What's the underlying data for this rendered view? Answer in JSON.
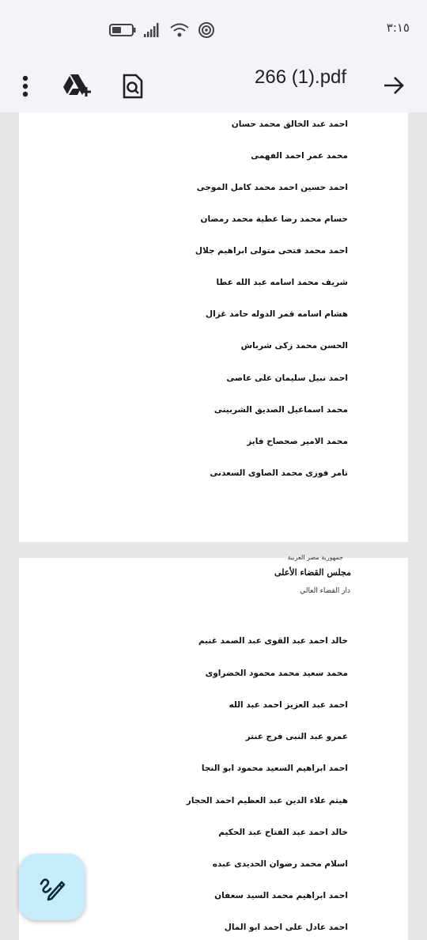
{
  "status": {
    "time": "٣:١٥"
  },
  "appbar": {
    "title": "266 (1).pdf"
  },
  "pages": [
    {
      "lines": [
        "احمد عبد الخالق محمد حسان",
        "محمد عمر احمد الفهمى",
        "احمد حسين احمد محمد كامل الموجى",
        "حسام محمد رضا عطية محمد رمضان",
        "احمد محمد فتحى متولى ابراهيم جلال",
        "شريف محمد اسامه عبد الله عطا",
        "هشام اسامه قمر الدوله حامد غزال",
        "الحسن محمد زكى شرباش",
        "احمد نبيل سليمان على عاصى",
        "محمد اسماعيل الصديق الشربينى",
        "محمد الامير صحصاح فايز",
        "تامر فوزى محمد الصاوى السعدنى"
      ]
    },
    {
      "header": {
        "line1": "جمهورية مصر العربية",
        "line2": "مجلس القضاء الأعلى",
        "line3": "دار القضاء العالي"
      },
      "lines": [
        "خالد احمد عبد القوى عبد الصمد غنيم",
        "محمد سعيد محمد محمود الخضراوى",
        "احمد عبد العزيز احمد عبد الله",
        "عمرو عبد النبى فرج عنتر",
        "احمد ابراهيم السعيد محمود ابو النجا",
        "هيثم علاء الدين عبد العظيم احمد الحجار",
        "خالد احمد عبد الفتاح عبد الحكيم",
        "اسلام محمد رضوان الحديدى عبده",
        "احمد ابراهيم محمد السيد سعفان",
        "احمد عادل على احمد ابو المال"
      ]
    }
  ],
  "icons": {
    "menu": "more-vert-icon",
    "drive": "add-to-drive-icon",
    "search": "search-document-icon",
    "forward": "arrow-forward-icon",
    "fab": "annotate-pen-icon"
  }
}
